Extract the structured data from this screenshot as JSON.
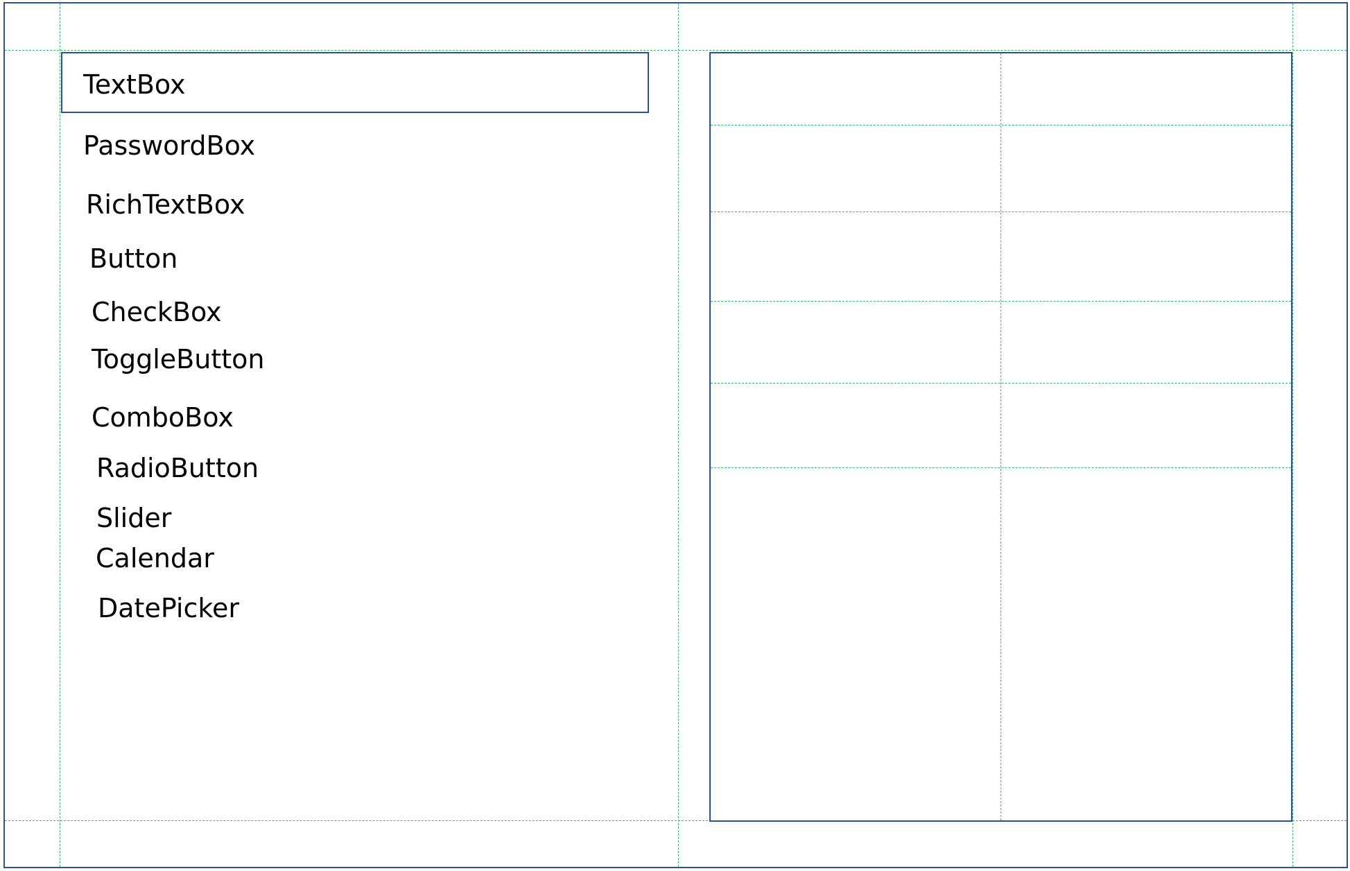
{
  "controls": {
    "textbox": "TextBox",
    "passwordbox": "PasswordBox",
    "richtextbox": "RichTextBox",
    "button": "Button",
    "checkbox": "CheckBox",
    "togglebutton": "ToggleButton",
    "combobox": "ComboBox",
    "radiobutton": "RadioButton",
    "slider": "Slider",
    "calendar": "Calendar",
    "datepicker": "DatePicker"
  },
  "colors": {
    "border": "#2f4f8f",
    "guide": "#3cb371"
  }
}
